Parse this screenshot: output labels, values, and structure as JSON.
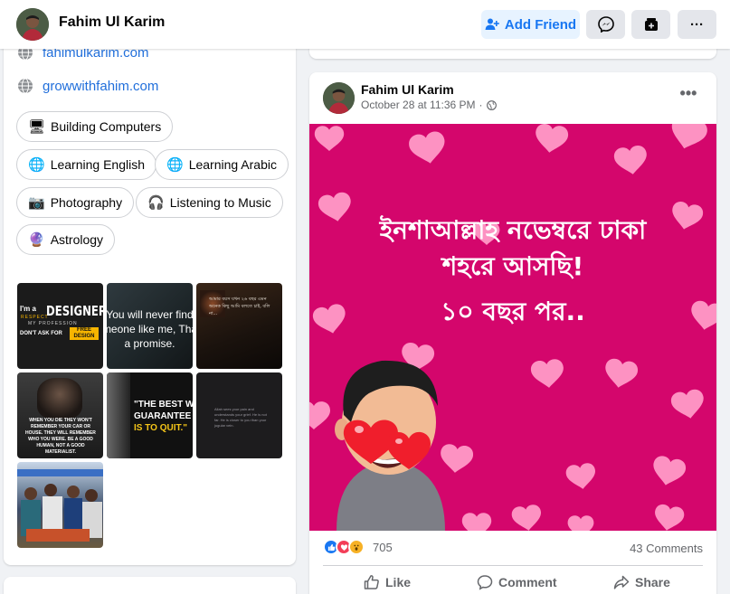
{
  "header": {
    "profile_name": "Fahim Ul Karim",
    "add_friend_label": "Add Friend",
    "more_label": "···"
  },
  "intro": {
    "links": [
      "fahimulkarim.com",
      "growwithfahim.com"
    ],
    "hobbies": [
      {
        "label": "Building Computers",
        "icon": "computer-icon"
      },
      {
        "label": "Learning English",
        "icon": "globe-icon"
      },
      {
        "label": "Learning Arabic",
        "icon": "globe-icon"
      },
      {
        "label": "Photography",
        "icon": "camera-icon"
      },
      {
        "label": "Listening to Music",
        "icon": "headphones-icon"
      },
      {
        "label": "Astrology",
        "icon": "crystal-ball-icon"
      }
    ]
  },
  "photos": {
    "p1": {
      "line1": "I'm a",
      "big": "DESIGNER",
      "sub": "MY PROFESSION",
      "tag": "DON'T ASK FOR",
      "tag2": "FREE DESIGN",
      "tag_small": "RESPECT"
    },
    "p2": {
      "line1": "You will never find",
      "line2": "someone like me, That's",
      "line3": "a promise."
    },
    "p3": {
      "text": "আমার বয়স যখন ২৬ বছর এমন অনেক কিছু আমি বলতে চাই, বলি না..."
    },
    "p4": {
      "text": "WHEN YOU DIE THEY WON'T REMEMBER YOUR CAR OR HOUSE. THEY WILL REMEMBER WHO YOU WERE. BE A GOOD HUMAN, NOT A GOOD MATERIALIST."
    },
    "p5": {
      "line1": "\"THE BEST WAY",
      "line2": "GUARANTEE A L",
      "line3": "IS TO QUIT.\""
    },
    "p6": {
      "text": "Allah sees your pain and understands your grief. He is not far. He is closer to you than your jugular vein."
    }
  },
  "post": {
    "author": "Fahim Ul Karim",
    "date": "October 28 at 11:36 PM",
    "dot": "·",
    "more": "•••",
    "image_line1": "ইনশাআল্লাহ নভেম্বরে ঢাকা",
    "image_line2": "শহরে আসছি!",
    "image_line3": "১০ বছর পর..",
    "reaction_count": "705",
    "comments": "43 Comments",
    "like_label": "Like",
    "comment_label": "Comment",
    "share_label": "Share"
  },
  "colors": {
    "accent": "#1877f2",
    "post_bg": "#d4066c",
    "heart": "#ff9ac8"
  }
}
